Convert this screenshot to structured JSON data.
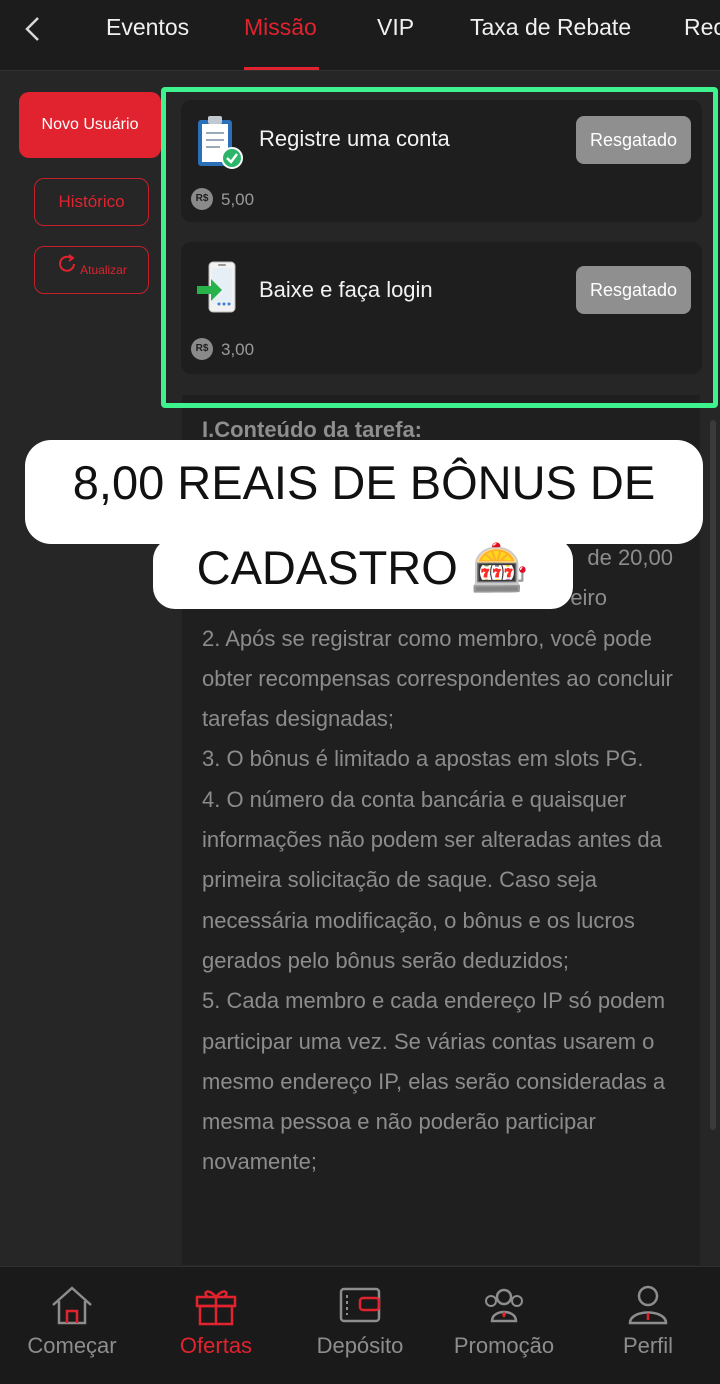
{
  "header": {
    "tabs": [
      {
        "label": "Eventos",
        "active": false
      },
      {
        "label": "Missão",
        "active": true
      },
      {
        "label": "VIP",
        "active": false
      },
      {
        "label": "Taxa de Rebate",
        "active": false
      },
      {
        "label": "Rec",
        "active": false
      }
    ]
  },
  "sidebar": {
    "new_user": "Novo Usuário",
    "history": "Histórico",
    "refresh": "Atualizar"
  },
  "tasks": [
    {
      "title": "Registre uma conta",
      "button": "Resgatado",
      "currency": "R$",
      "reward": "5,00",
      "icon": "clipboard-check-icon"
    },
    {
      "title": "Baixe e faça login",
      "button": "Resgatado",
      "currency": "R$",
      "reward": "3,00",
      "icon": "phone-download-icon"
    }
  ],
  "content": {
    "heading": "I.Conteúdo da tarefa:",
    "rules": [
      "de 20,00",
      "eiro",
      "2. Após se registrar como membro, você pode obter recompensas correspondentes ao concluir tarefas designadas;",
      "3. O bônus é limitado a apostas em slots PG.",
      "4. O número da conta bancária e quaisquer informações não podem ser alteradas antes da primeira solicitação de saque. Caso seja necessária modificação, o bônus e os lucros gerados pelo bônus serão deduzidos;",
      "5. Cada membro e cada endereço IP só podem participar uma vez. Se várias contas usarem o mesmo endereço IP, elas serão consideradas a mesma pessoa e não poderão participar novamente;"
    ]
  },
  "overlay": {
    "line1": "8,00 REAIS DE BÔNUS DE",
    "line2": "CADASTRO 🎰"
  },
  "bottom_nav": [
    {
      "label": "Começar",
      "icon": "home-icon",
      "active": false
    },
    {
      "label": "Ofertas",
      "icon": "gift-icon",
      "active": true
    },
    {
      "label": "Depósito",
      "icon": "wallet-icon",
      "active": false
    },
    {
      "label": "Promoção",
      "icon": "people-icon",
      "active": false
    },
    {
      "label": "Perfil",
      "icon": "user-icon",
      "active": false
    }
  ],
  "colors": {
    "accent": "#e0232e",
    "highlight": "#3ef28e",
    "background": "#262626"
  }
}
